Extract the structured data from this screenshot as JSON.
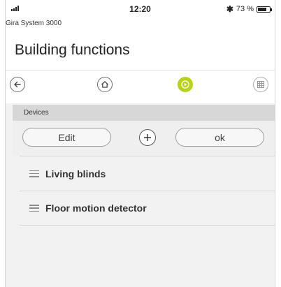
{
  "status_bar": {
    "time": "12:20",
    "bluetooth_icon": "bluetooth-icon",
    "battery_text": "73 %",
    "battery_level": 0.73
  },
  "header": {
    "app_name": "Gira System 3000",
    "title": "Building functions"
  },
  "toolbar": {
    "icons": [
      "back-arrow-icon",
      "home-icon",
      "play-circle-icon",
      "grid-icon"
    ],
    "active_color": "#b6d31a"
  },
  "section": {
    "label": "Devices"
  },
  "edit_row": {
    "edit_label": "Edit",
    "add_icon": "plus-icon",
    "ok_label": "ok"
  },
  "devices": [
    {
      "label": "Living blinds"
    },
    {
      "label": "Floor motion detector"
    }
  ]
}
